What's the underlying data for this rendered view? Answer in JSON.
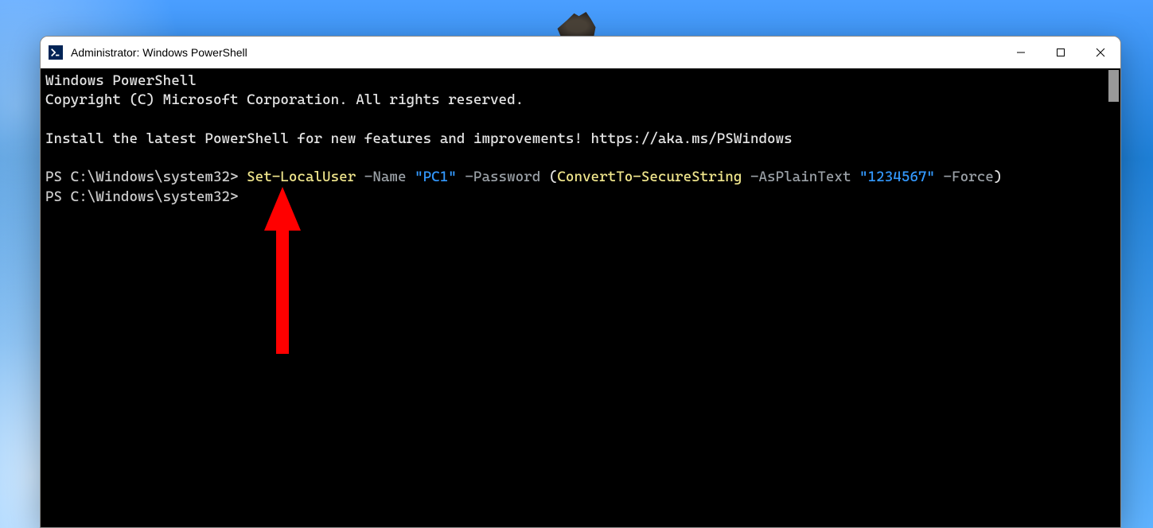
{
  "window": {
    "title": "Administrator: Windows PowerShell"
  },
  "terminal": {
    "banner_line1": "Windows PowerShell",
    "banner_line2": "Copyright (C) Microsoft Corporation. All rights reserved.",
    "install_line": "Install the latest PowerShell for new features and improvements! https://aka.ms/PSWindows",
    "prompt": "PS C:\\Windows\\system32>",
    "cmd": {
      "cmdlet": "Set-LocalUser",
      "p_name": "-Name",
      "v_name": "\"PC1\"",
      "p_password": "-Password",
      "paren_open": "(",
      "convert": "ConvertTo-SecureString",
      "p_asplain": "-AsPlainText",
      "v_pwd": "\"1234567\"",
      "p_force": "-Force",
      "paren_close": ")"
    }
  }
}
